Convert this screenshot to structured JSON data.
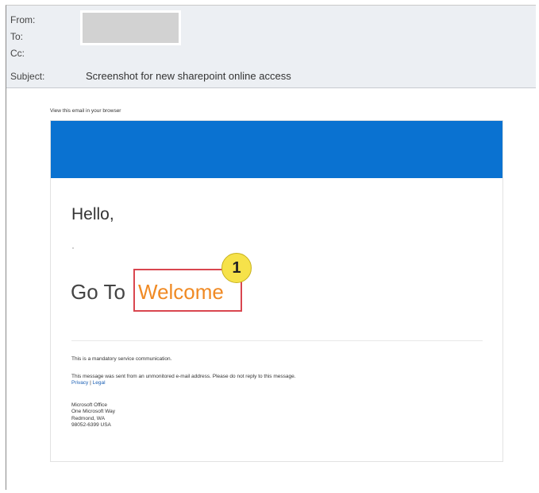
{
  "header": {
    "from_label": "From:",
    "to_label": "To:",
    "cc_label": "Cc:",
    "subject_label": "Subject:",
    "subject_value": "Screenshot for new sharepoint online access"
  },
  "email": {
    "view_in_browser": "View this email in your browser",
    "greeting": "Hello,",
    "goto_text": "Go To",
    "welcome_link": "Welcome",
    "step_number": "1",
    "footer": {
      "mandatory": "This is a mandatory service communication.",
      "unmonitored": "This message was sent from an unmonitored e-mail address. Please do not reply to this message.",
      "privacy": "Privacy",
      "separator": "|",
      "legal": "Legal",
      "address_line1": "Microsoft Office",
      "address_line2": "One Microsoft Way",
      "address_line3": "Redmond, WA",
      "address_line4": "98052-6399 USA"
    }
  },
  "colors": {
    "banner": "#0a72d1",
    "welcome": "#f08a24",
    "highlight_border": "#d9464f",
    "badge": "#f6e24a"
  }
}
